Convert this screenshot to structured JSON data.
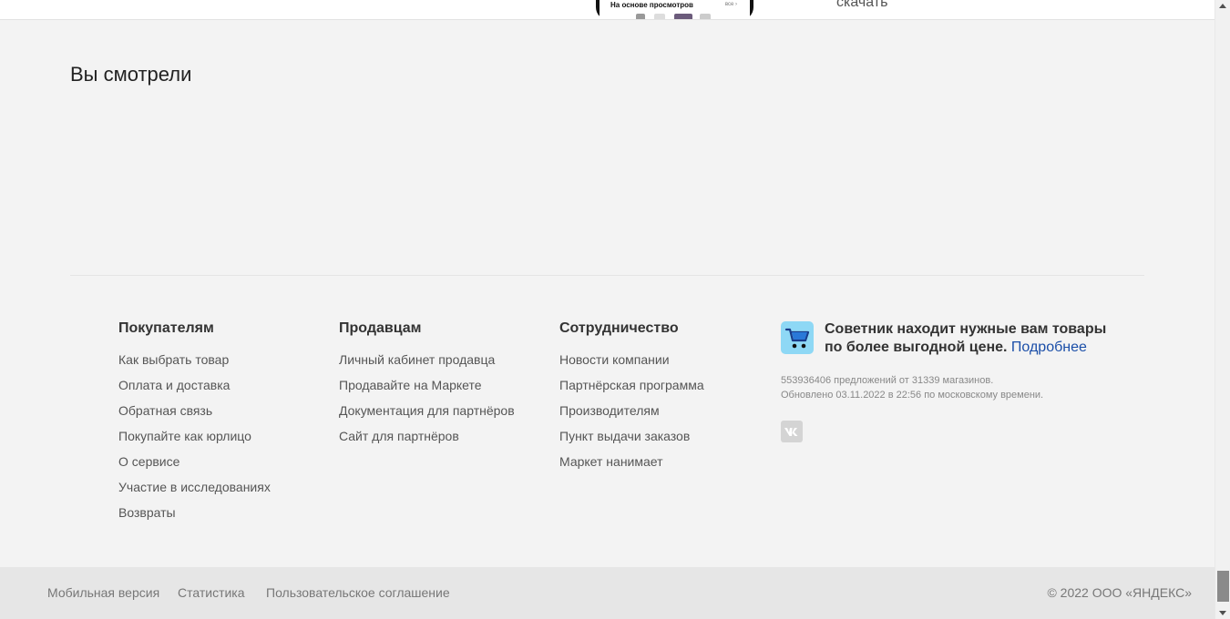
{
  "top": {
    "phone_caption": "На основе просмотров",
    "phone_more": "все ›",
    "download": "скачать"
  },
  "viewed": {
    "title": "Вы смотрели"
  },
  "footer": {
    "columns": [
      {
        "title": "Покупателям",
        "links": [
          "Как выбрать товар",
          "Оплата и доставка",
          "Обратная связь",
          "Покупайте как юрлицо",
          "О сервисе",
          "Участие в исследованиях",
          "Возвраты"
        ]
      },
      {
        "title": "Продавцам",
        "links": [
          "Личный кабинет продавца",
          "Продавайте на Маркете",
          "Документация для партнёров",
          "Сайт для партнёров"
        ]
      },
      {
        "title": "Сотрудничество",
        "links": [
          "Новости компании",
          "Партнёрская программа",
          "Производителям",
          "Пункт выдачи заказов",
          "Маркет нанимает"
        ]
      }
    ],
    "adviser": {
      "text": "Советник находит нужные вам товары по более выгодной цене.",
      "link": "Подробнее"
    },
    "stats": {
      "line1": "553936406 предложений от 31339 магазинов.",
      "line2": "Обновлено 03.11.2022 в 22:56 по московскому времени."
    },
    "social": {
      "vk_icon": "vk-icon"
    }
  },
  "bottom": {
    "links": [
      "Мобильная версия",
      "Статистика",
      "Пользовательское соглашение"
    ],
    "copyright": "© 2022  ООО «ЯНДЕКС»"
  },
  "colors": {
    "page_bg": "#f3f3f3",
    "bottom_bg": "#e6e6e6",
    "link_blue": "#1a4ea8",
    "adviser_icon_bg": "#8ed8f5"
  }
}
